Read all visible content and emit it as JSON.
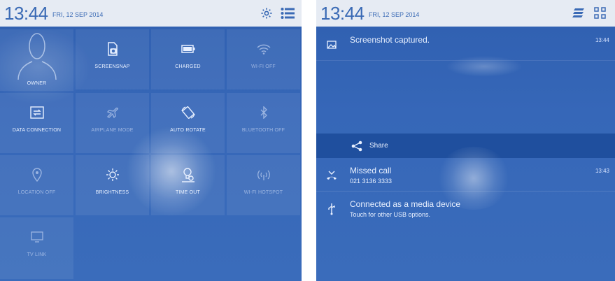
{
  "left": {
    "status": {
      "time": "13:44",
      "date": "FRI, 12 SEP 2014",
      "icons": [
        "gear-icon",
        "list-icon"
      ]
    },
    "tiles": [
      {
        "label": "OWNER",
        "icon": "person-icon"
      },
      {
        "label": "SCREENSNAP",
        "icon": "screenshot-icon"
      },
      {
        "label": "CHARGED",
        "icon": "battery-icon"
      },
      {
        "label": "WI-FI OFF",
        "icon": "wifi-icon"
      },
      {
        "label": "DATA CONNECTION",
        "icon": "data-connection-icon"
      },
      {
        "label": "AIRPLANE MODE",
        "icon": "airplane-icon"
      },
      {
        "label": "AUTO ROTATE",
        "icon": "rotate-icon"
      },
      {
        "label": "BLUETOOTH OFF",
        "icon": "bluetooth-icon"
      },
      {
        "label": "LOCATION OFF",
        "icon": "location-icon"
      },
      {
        "label": "BRIGHTNESS",
        "icon": "brightness-icon"
      },
      {
        "label": "TIME OUT",
        "icon": "timeout-icon"
      },
      {
        "label": "WI-FI HOTSPOT",
        "icon": "hotspot-icon"
      },
      {
        "label": "TV LINK",
        "icon": "tv-icon"
      }
    ]
  },
  "right": {
    "status": {
      "time": "13:44",
      "date": "FRI, 12 SEP 2014",
      "icons": [
        "clear-notifications-icon",
        "quick-settings-icon"
      ]
    },
    "notifications": {
      "screenshot": {
        "title": "Screenshot captured.",
        "time": "13:44",
        "action": "Share"
      },
      "missed_call": {
        "title": "Missed call",
        "number": "021 3136 3333",
        "time": "13:43"
      },
      "usb": {
        "title": "Connected as a media device",
        "subtitle": "Touch for other USB options."
      }
    }
  },
  "colors": {
    "accent": "#3a6ab5",
    "panel": "#3667b8",
    "status_bar": "#e6ebf3",
    "share_bar": "#1f4f9e"
  }
}
